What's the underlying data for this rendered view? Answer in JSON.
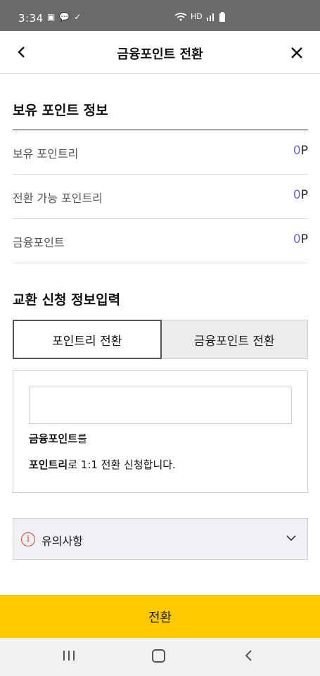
{
  "status": {
    "time": "3:34",
    "notif_icons": [
      "▣",
      "💬",
      "✓"
    ],
    "right_icons": [
      "wifi",
      "HD",
      "signal",
      "battery"
    ]
  },
  "appbar": {
    "title": "금융포인트 전환",
    "back_glyph": "‹",
    "close_glyph": "✕"
  },
  "holdings": {
    "title": "보유 포인트 정보",
    "rows": [
      {
        "label": "보유 포인트리",
        "value": "0",
        "unit": "P"
      },
      {
        "label": "전환 가능 포인트리",
        "value": "0",
        "unit": "P"
      },
      {
        "label": "금융포인트",
        "value": "0",
        "unit": "P"
      }
    ]
  },
  "exchange": {
    "title": "교환 신청 정보입력",
    "tabs": [
      {
        "label": "포인트리 전환"
      },
      {
        "label": "금융포인트 전환"
      }
    ],
    "input": {
      "value": "",
      "placeholder": ""
    },
    "line1_bold": "금융포인트",
    "line1_rest": "를",
    "line2_bold": "포인트리",
    "line2_rest": "로 1:1 전환 신청합니다."
  },
  "notice": {
    "label": "유의사항",
    "info_glyph": "i",
    "chevron": "∨"
  },
  "cta": {
    "label": "전환"
  },
  "colors": {
    "cta": "#ffc900",
    "value_accent": "#6b6bd6",
    "info_icon": "#e0402e"
  }
}
